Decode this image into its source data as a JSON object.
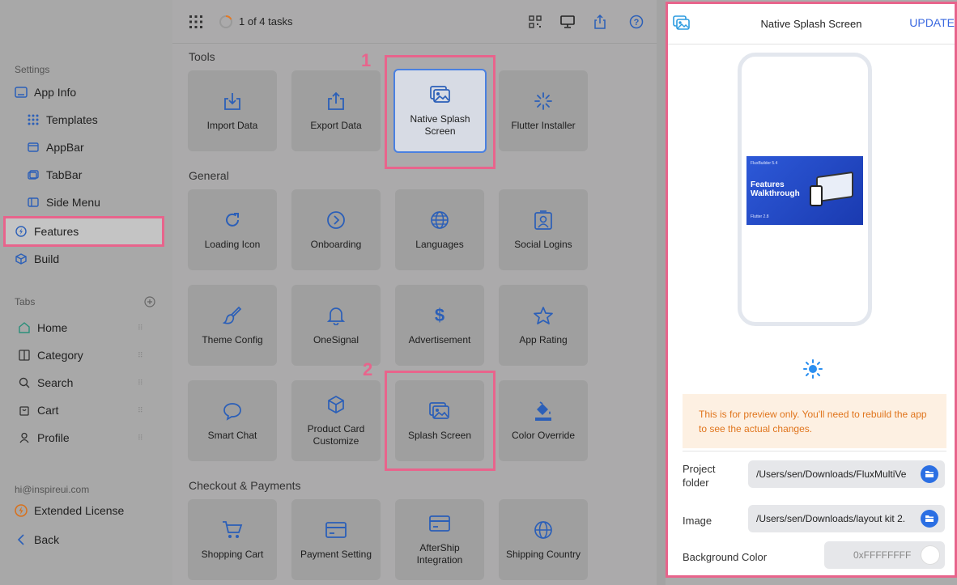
{
  "sidebar": {
    "settings_label": "Settings",
    "app_info": "App Info",
    "templates": "Templates",
    "appbar": "AppBar",
    "tabbar": "TabBar",
    "side_menu": "Side Menu",
    "features": "Features",
    "build": "Build",
    "tabs_label": "Tabs",
    "tabs": [
      "Home",
      "Category",
      "Search",
      "Cart",
      "Profile"
    ],
    "email": "hi@inspireui.com",
    "license": "Extended License",
    "back": "Back"
  },
  "topbar": {
    "tasks": "1 of 4 tasks"
  },
  "sections": {
    "tools": "Tools",
    "general": "General",
    "checkout": "Checkout & Payments"
  },
  "cards": {
    "import_data": "Import Data",
    "export_data": "Export Data",
    "native_splash": "Native Splash Screen",
    "flutter_installer": "Flutter Installer",
    "loading_icon": "Loading Icon",
    "onboarding": "Onboarding",
    "languages": "Languages",
    "social_logins": "Social Logins",
    "theme_config": "Theme Config",
    "onesignal": "OneSignal",
    "advertisement": "Advertisement",
    "app_rating": "App Rating",
    "smart_chat": "Smart Chat",
    "product_card": "Product Card Customize",
    "splash_screen": "Splash Screen",
    "color_override": "Color Override",
    "shopping_cart": "Shopping Cart",
    "payment_setting": "Payment Setting",
    "aftership": "AfterShip Integration",
    "shipping_country": "Shipping Country"
  },
  "annotations": {
    "one": "1",
    "two": "2"
  },
  "panel": {
    "title": "Native Splash Screen",
    "update": "UPDATE",
    "splash": {
      "brand": "FluxBuilder 5.4",
      "headline": "Features Walkthrough",
      "footer": "Flutter 2.8"
    },
    "notice": "This is for preview only. You'll need to rebuild the app to see the actual changes.",
    "project_folder_label": "Project folder",
    "project_folder_value": "/Users/sen/Downloads/FluxMultiVe",
    "image_label": "Image",
    "image_value": "/Users/sen/Downloads/layout kit 2.",
    "bg_color_label": "Background Color",
    "bg_color_value": "0xFFFFFFFF"
  },
  "colors": {
    "accent": "#2b6fe3",
    "highlight": "#e8648c",
    "notice_text": "#e0751d",
    "notice_bg": "#fdf0e2"
  }
}
